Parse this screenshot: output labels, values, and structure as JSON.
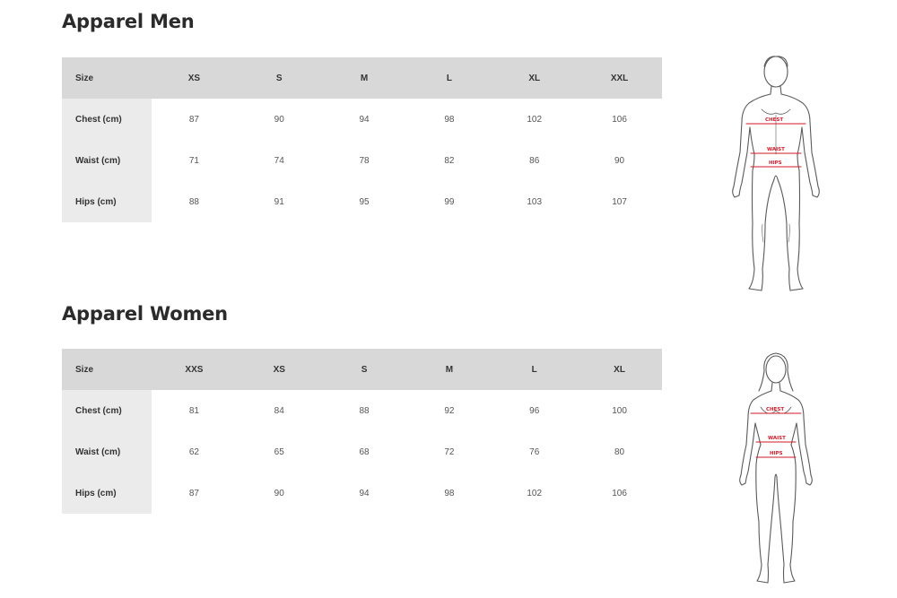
{
  "men": {
    "title": "Apparel Men",
    "columns": [
      "Size",
      "XS",
      "S",
      "M",
      "L",
      "XL",
      "XXL"
    ],
    "rows": [
      {
        "label": "Chest (cm)",
        "values": [
          "87",
          "90",
          "94",
          "98",
          "102",
          "106"
        ]
      },
      {
        "label": "Waist (cm)",
        "values": [
          "71",
          "74",
          "78",
          "82",
          "86",
          "90"
        ]
      },
      {
        "label": "Hips (cm)",
        "values": [
          "88",
          "91",
          "95",
          "99",
          "103",
          "107"
        ]
      }
    ],
    "figure_labels": {
      "chest": "CHEST",
      "waist": "WAIST",
      "hips": "HIPS"
    }
  },
  "women": {
    "title": "Apparel Women",
    "columns": [
      "Size",
      "XXS",
      "XS",
      "S",
      "M",
      "L",
      "XL"
    ],
    "rows": [
      {
        "label": "Chest (cm)",
        "values": [
          "81",
          "84",
          "88",
          "92",
          "96",
          "100"
        ]
      },
      {
        "label": "Waist (cm)",
        "values": [
          "62",
          "65",
          "68",
          "72",
          "76",
          "80"
        ]
      },
      {
        "label": "Hips (cm)",
        "values": [
          "87",
          "90",
          "94",
          "98",
          "102",
          "106"
        ]
      }
    ],
    "figure_labels": {
      "chest": "CHEST",
      "waist": "WAIST",
      "hips": "HIPS"
    }
  },
  "colors": {
    "header_bg": "#d8d8d8",
    "row_header_bg": "#ebebeb",
    "measure_line": "#d11a2a"
  }
}
